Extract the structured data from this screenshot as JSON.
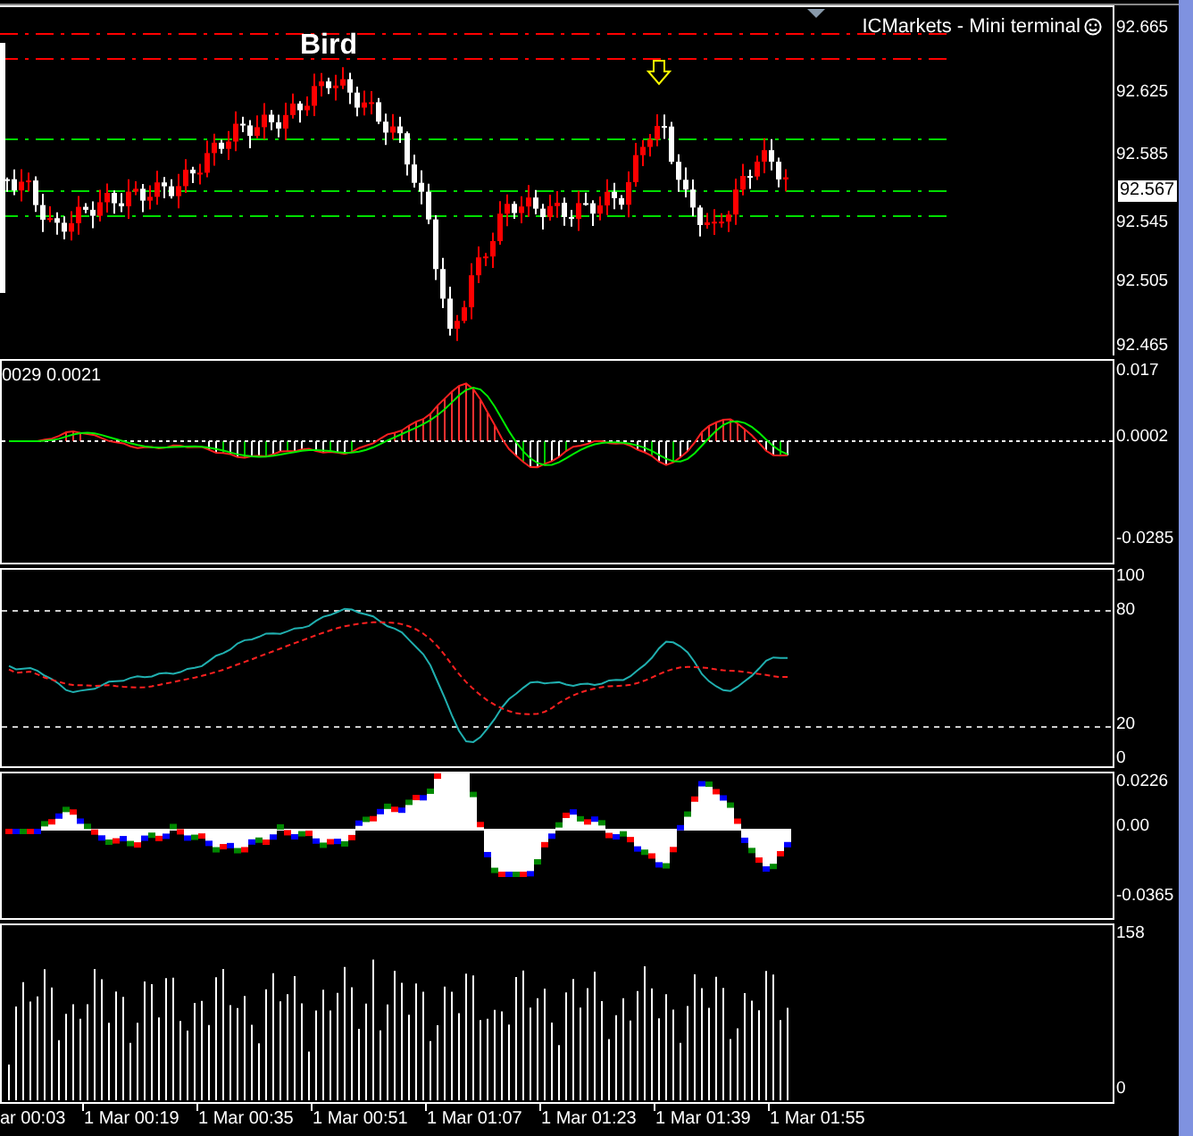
{
  "chart_window": {
    "title": "ICMarkets - Mini terminal",
    "label": "Bird",
    "current_price": "92.567",
    "price_axis": [
      "92.665",
      "92.625",
      "92.585",
      "92.545",
      "92.505",
      "92.465"
    ]
  },
  "macd_panel": {
    "label": "0029 0.0021",
    "axis": [
      "0.017",
      "0.0002",
      "-0.0285"
    ]
  },
  "stochastic_panel": {
    "axis": [
      "100",
      "80",
      "20",
      "0"
    ]
  },
  "histogram_panel": {
    "axis": [
      "0.0226",
      "0.00",
      "-0.0365"
    ]
  },
  "volume_panel": {
    "axis": [
      "158",
      "0"
    ]
  },
  "time_axis": [
    "ar 00:03",
    "1 Mar 00:19",
    "1 Mar 00:35",
    "1 Mar 00:51",
    "1 Mar 01:07",
    "1 Mar 01:23",
    "1 Mar 01:39",
    "1 Mar 01:55"
  ]
}
